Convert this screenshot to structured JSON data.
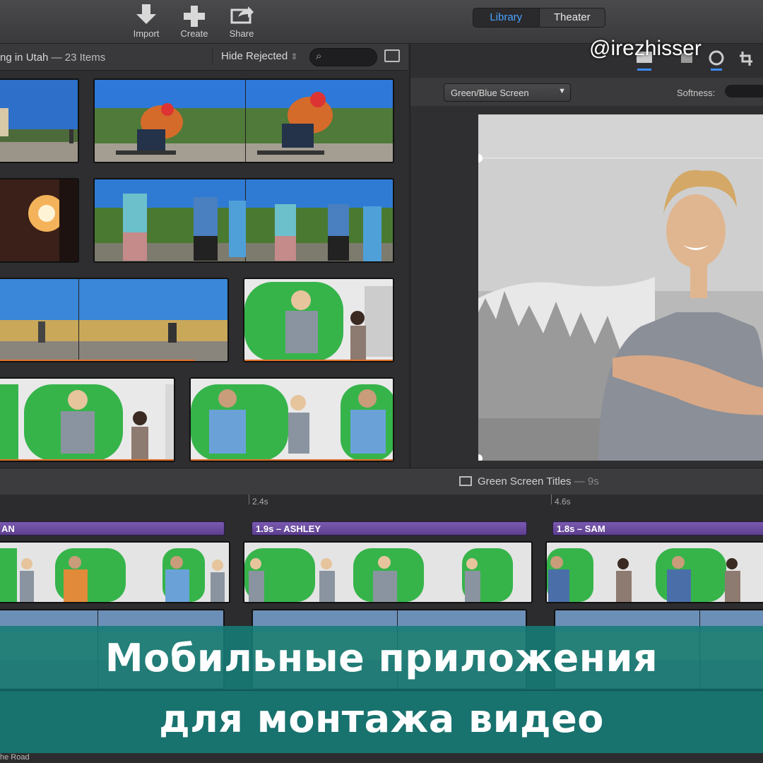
{
  "toolbar": {
    "import_label": "Import",
    "create_label": "Create",
    "share_label": "Share",
    "library_tab": "Library",
    "theater_tab": "Theater"
  },
  "browser": {
    "event_title": "ng in Utah",
    "item_count": "— 23 Items",
    "filter_label": "Hide Rejected",
    "filter_arrows": "⇕"
  },
  "viewer": {
    "effect_select": "Green/Blue Screen",
    "softness_label": "Softness:"
  },
  "watermark": "@irezhisser",
  "timeline": {
    "project_title": "Green Screen Titles",
    "project_duration": "— 9s",
    "tick_1": "2.4s",
    "tick_2": "4.6s",
    "title_clip_1": "AN",
    "title_clip_2": "1.9s – ASHLEY",
    "title_clip_3": "1.8s – SAM",
    "background_track_label": "he Road"
  },
  "banner": {
    "line1": "Мобильные приложения",
    "line2": "для монтажа видео"
  },
  "colors": {
    "accent_blue": "#4aa3ff",
    "title_purple": "#6b4aa0",
    "green_screen": "#3db34a",
    "banner_teal": "#167c78"
  }
}
